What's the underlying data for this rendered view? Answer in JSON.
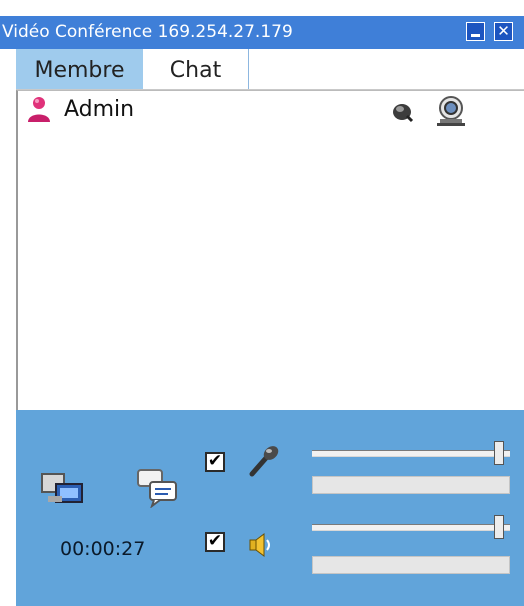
{
  "window": {
    "title": "Vidéo Conférence 169.254.27.179",
    "minimize_icon": "minimize-icon",
    "close_icon": "close-icon",
    "close_label": "✕"
  },
  "tabs": [
    {
      "label": "Membre",
      "active": true
    },
    {
      "label": "Chat",
      "active": false
    }
  ],
  "members": [
    {
      "name": "Admin",
      "icons": [
        "user-icon",
        "microphone-icon",
        "webcam-icon"
      ]
    }
  ],
  "controls": {
    "screen_share_icon": "screen-share-icon",
    "chat_icon": "chat-bubbles-icon",
    "microphone": {
      "enabled": true,
      "check_mark": "✔",
      "volume_percent": 97,
      "level_percent": 0
    },
    "speaker": {
      "enabled": true,
      "check_mark": "✔",
      "volume_percent": 97,
      "level_percent": 0
    },
    "timer": "00:00:27"
  },
  "colors": {
    "titlebar": "#3f7fd8",
    "active_tab": "#9fcbed",
    "control_panel": "#61a4da"
  }
}
